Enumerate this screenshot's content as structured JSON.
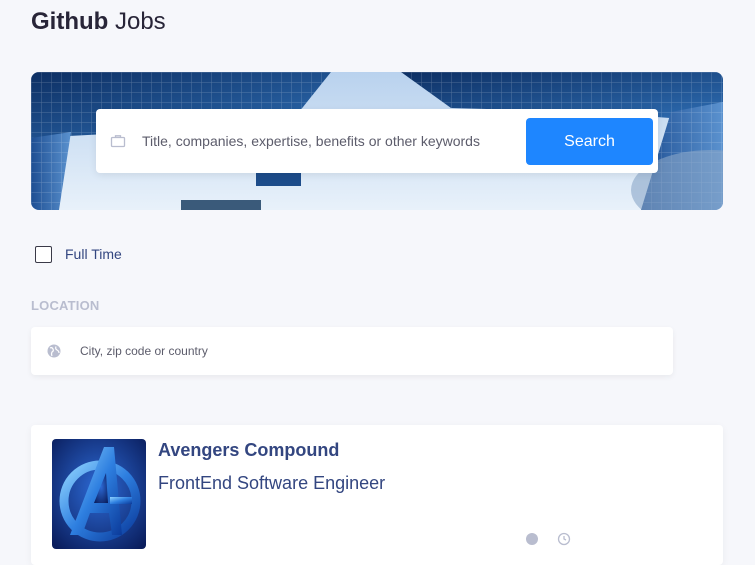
{
  "header": {
    "logo_bold": "Github",
    "logo_light": "Jobs"
  },
  "search": {
    "placeholder": "Title, companies, expertise, benefits or other keywords",
    "button_label": "Search"
  },
  "filters": {
    "full_time_label": "Full Time",
    "full_time_checked": false
  },
  "location": {
    "title": "LOCATION",
    "placeholder": "City, zip code or country"
  },
  "jobs": [
    {
      "company": "Avengers Compound",
      "title": "FrontEnd Software Engineer",
      "location": "",
      "posted": ""
    }
  ],
  "colors": {
    "accent": "#1e86ff",
    "heading": "#334680",
    "muted": "#b9bdcf",
    "background": "#f6f7fb"
  }
}
